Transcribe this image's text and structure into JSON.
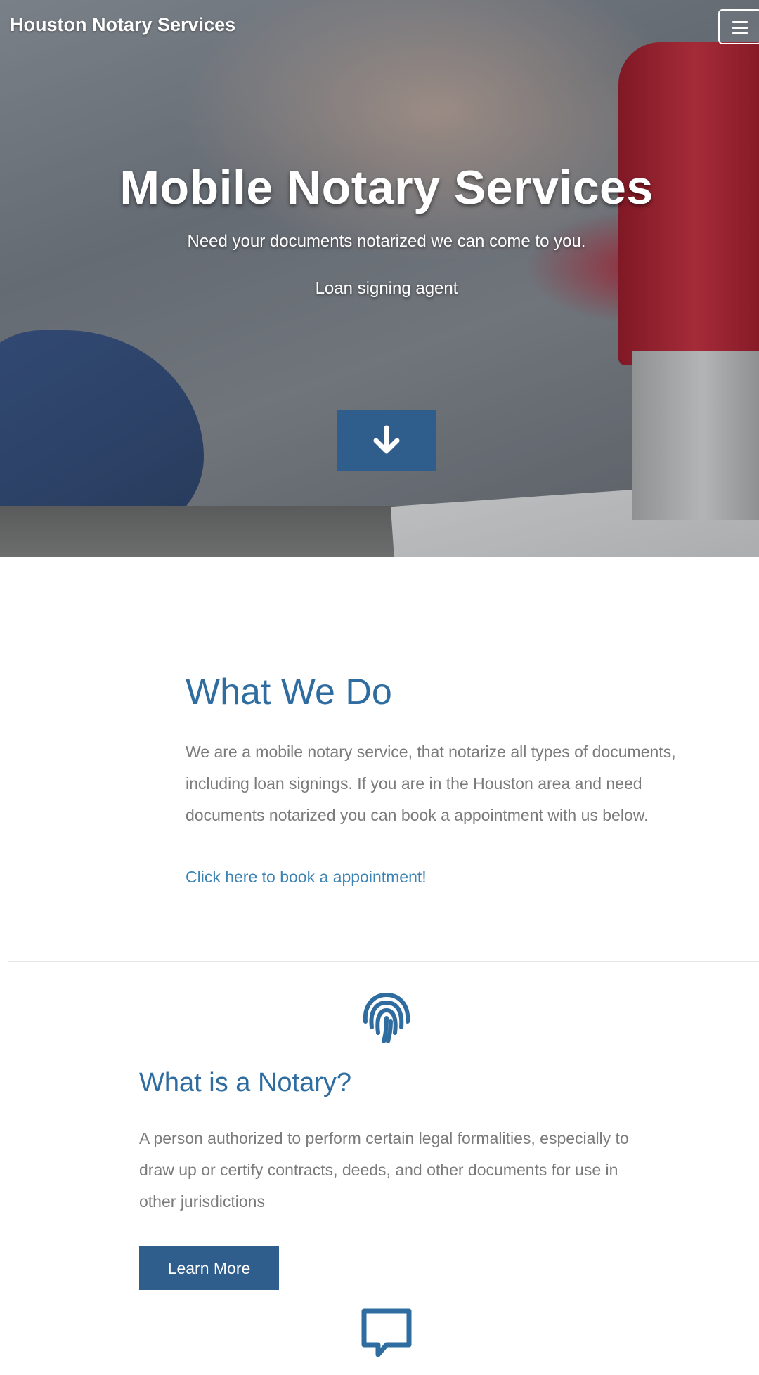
{
  "header": {
    "brand": "Houston Notary Services",
    "menu_icon": "hamburger-icon"
  },
  "hero": {
    "title": "Mobile Notary Services",
    "subtitle": "Need your documents notarized we can come to you.",
    "tagline": "Loan signing agent",
    "scroll_icon": "arrow-down-icon",
    "accent_color": "#2f5d8c"
  },
  "what_we_do": {
    "title": "What We Do",
    "body": "We are a mobile notary service, that notarize all types of documents, including loan signings. If you are in the Houston area and need documents notarized you can book a appointment with us below.",
    "link_label": "Click here to book a appointment!",
    "title_color": "#2f6da0",
    "link_color": "#3b83b4"
  },
  "notary": {
    "icon": "fingerprint-icon",
    "title": "What is a Notary?",
    "body": "A person authorized to perform certain legal formalities, especially to draw up or certify contracts, deeds, and other documents for use in other jurisdictions",
    "button_label": "Learn More"
  },
  "next_section": {
    "icon": "chat-bubble-icon"
  }
}
